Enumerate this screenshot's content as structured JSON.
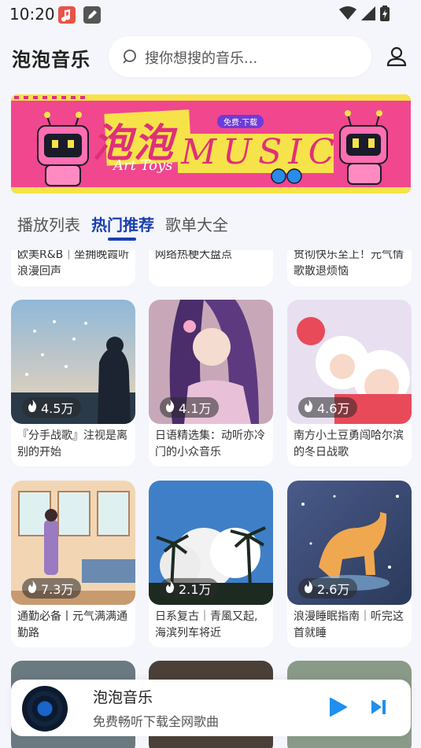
{
  "status": {
    "time": "10:20"
  },
  "header": {
    "title": "泡泡音乐",
    "search_placeholder": "搜你想搜的音乐..."
  },
  "banner": {
    "main_text": "泡泡",
    "music_text": "MUSIC",
    "sub_text": "Art Toys",
    "tag": "免费·下载"
  },
  "tabs": [
    {
      "label": "播放列表",
      "active": false
    },
    {
      "label": "热门推荐",
      "active": true
    },
    {
      "label": "歌单大全",
      "active": false
    }
  ],
  "cards_partial": [
    {
      "title": "欧美R&B｜坐拥晚霞听浪漫回声"
    },
    {
      "title": "网络热梗大盘点"
    },
    {
      "title": "贯彻快乐至上！元气情歌散退烦恼"
    }
  ],
  "cards": [
    {
      "plays": "4.5万",
      "title": "『分手战歌』注视是离别的开始"
    },
    {
      "plays": "4.1万",
      "title": "日语精选集：动听亦冷门的小众音乐"
    },
    {
      "plays": "4.6万",
      "title": "南方小土豆勇闯哈尔滨的冬日战歌"
    },
    {
      "plays": "7.3万",
      "title": "通勤必备丨元气满满通勤路"
    },
    {
      "plays": "2.1万",
      "title": "日系复古｜青風又起,海滨列车将近"
    },
    {
      "plays": "2.6万",
      "title": "浪漫睡眠指南｜听完这首就睡"
    }
  ],
  "mini_player": {
    "title": "泡泡音乐",
    "subtitle": "免费畅听下载全网歌曲"
  },
  "colors": {
    "accent": "#1a3fb0",
    "player_icon": "#1f8ff0",
    "banner_bg": "#f0478f",
    "banner_text": "#f6e34a"
  }
}
